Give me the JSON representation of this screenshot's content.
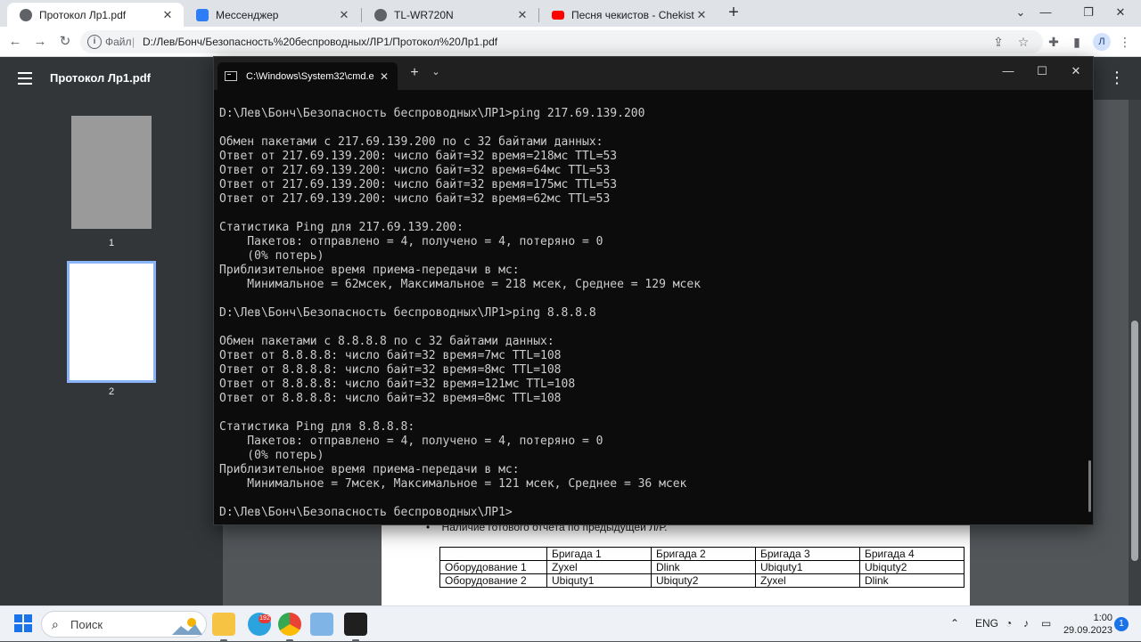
{
  "browser": {
    "tabs": [
      {
        "title": "Протокол Лр1.pdf",
        "favicon": "globe-icon",
        "active": true
      },
      {
        "title": "Мессенджер",
        "favicon": "messenger-icon",
        "active": false
      },
      {
        "title": "TL-WR720N",
        "favicon": "globe-icon",
        "active": false
      },
      {
        "title": "Песня чекистов - Chekists' song",
        "favicon": "youtube-icon",
        "active": false
      }
    ],
    "new_tab_label": "+",
    "address": {
      "scheme_label": "Файл",
      "separator": "|",
      "url": "D:/Лев/Бонч/Безопасность%20беспроводных/ЛР1/Протокол%20Лр1.pdf"
    },
    "profile_initial": "Л",
    "colors": {
      "tabstrip": "#dfe3e8",
      "toolbar": "#ffffff",
      "accent": "#1a73e8"
    }
  },
  "pdf": {
    "title": "Протокол Лр1.pdf",
    "thumbnails": [
      {
        "number": "1"
      },
      {
        "number": "2"
      }
    ],
    "selected_page": 2,
    "bullet_text": "Наличие готового отчета по предыдущей Л/Р.",
    "table": {
      "header": [
        "",
        "Бригада 1",
        "Бригада 2",
        "Бригада 3",
        "Бригада 4"
      ],
      "rows": [
        [
          "Оборудование 1",
          "Zyxel",
          "Dlink",
          "Ubiquty1",
          "Ubiquty2"
        ],
        [
          "Оборудование 2",
          "Ubiquty1",
          "Ubiquty2",
          "Zyxel",
          "Dlink"
        ]
      ]
    }
  },
  "cmd": {
    "tab_title": "C:\\Windows\\System32\\cmd.e",
    "new_tab_label": "+",
    "lines": [
      "D:\\Лев\\Бонч\\Безопасность беспроводных\\ЛР1>ping 217.69.139.200",
      "",
      "Обмен пакетами с 217.69.139.200 по с 32 байтами данных:",
      "Ответ от 217.69.139.200: число байт=32 время=218мс TTL=53",
      "Ответ от 217.69.139.200: число байт=32 время=64мс TTL=53",
      "Ответ от 217.69.139.200: число байт=32 время=175мс TTL=53",
      "Ответ от 217.69.139.200: число байт=32 время=62мс TTL=53",
      "",
      "Статистика Ping для 217.69.139.200:",
      "    Пакетов: отправлено = 4, получено = 4, потеряно = 0",
      "    (0% потерь)",
      "Приблизительное время приема-передачи в мс:",
      "    Минимальное = 62мсек, Максимальное = 218 мсек, Среднее = 129 мсек",
      "",
      "D:\\Лев\\Бонч\\Безопасность беспроводных\\ЛР1>ping 8.8.8.8",
      "",
      "Обмен пакетами с 8.8.8.8 по с 32 байтами данных:",
      "Ответ от 8.8.8.8: число байт=32 время=7мс TTL=108",
      "Ответ от 8.8.8.8: число байт=32 время=8мс TTL=108",
      "Ответ от 8.8.8.8: число байт=32 время=121мс TTL=108",
      "Ответ от 8.8.8.8: число байт=32 время=8мс TTL=108",
      "",
      "Статистика Ping для 8.8.8.8:",
      "    Пакетов: отправлено = 4, получено = 4, потеряно = 0",
      "    (0% потерь)",
      "Приблизительное время приема-передачи в мс:",
      "    Минимальное = 7мсек, Максимальное = 121 мсек, Среднее = 36 мсек",
      "",
      "D:\\Лев\\Бонч\\Безопасность беспроводных\\ЛР1>"
    ],
    "colors": {
      "background": "#0c0c0c",
      "text": "#cccccc",
      "titlebar": "#202020"
    }
  },
  "taskbar": {
    "search_placeholder": "Поиск",
    "telegram_badge": "192",
    "language": "ENG",
    "time": "1:00",
    "date": "29.09.2023",
    "notification_count": "1"
  }
}
